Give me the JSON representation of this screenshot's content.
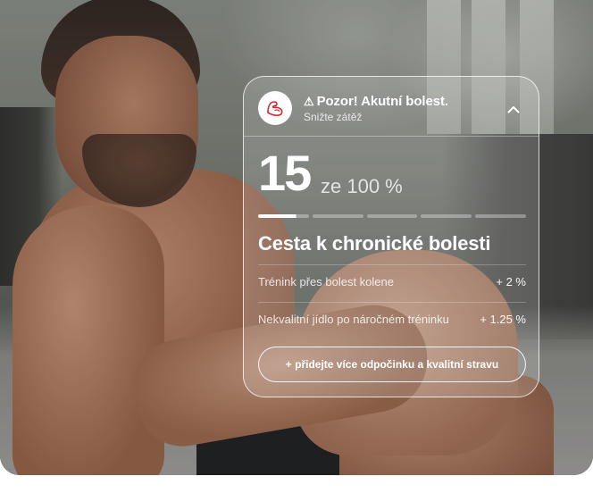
{
  "alert": {
    "icon": "flexed-arm-icon",
    "icon_color": "#d9262c",
    "warning_glyph": "⚠",
    "title": "Pozor! Akutní bolest.",
    "subtitle": "Snižte zátěž"
  },
  "score": {
    "value": "15",
    "suffix": "ze 100 %",
    "progress_fraction": 0.15,
    "segment_count": 5
  },
  "card": {
    "title": "Cesta k chronické bolesti",
    "rows": [
      {
        "label": "Trénink přes bolest kolene",
        "value": "+ 2 %"
      },
      {
        "label": "Nekvalitní jídlo po náročném tréninku",
        "value": "+ 1.25 %"
      }
    ],
    "cta_label": "+ přidejte více odpočinku a kvalitní stravu"
  },
  "colors": {
    "accent": "#ffffff",
    "danger": "#d9262c"
  }
}
